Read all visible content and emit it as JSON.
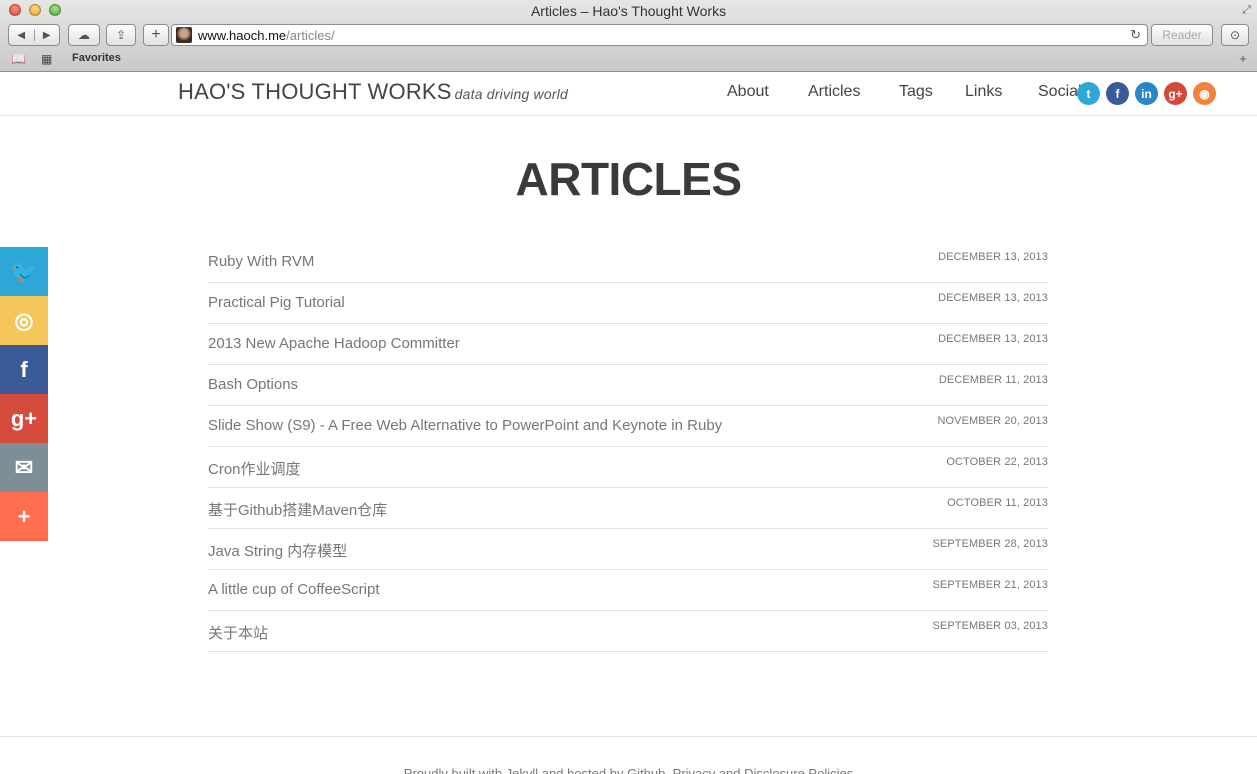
{
  "window": {
    "title": "Articles – Hao's Thought Works"
  },
  "toolbar": {
    "back_glyph": "◀",
    "forward_glyph": "▶",
    "cloud_glyph": "☁",
    "share_glyph": "⇪",
    "newtab_glyph": "+",
    "url_host": "www.haoch.me",
    "url_path": "/articles/",
    "reload_glyph": "↻",
    "reader_label": "Reader",
    "download_glyph": "⊙"
  },
  "bookmarks": {
    "book_glyph": "📖",
    "grid_glyph": "▦",
    "favorites_label": "Favorites",
    "add_glyph": "+"
  },
  "site": {
    "brand": "HAO'S THOUGHT WORKS",
    "tagline": "data driving world"
  },
  "nav": [
    "About",
    "Articles",
    "Tags",
    "Links",
    "Social"
  ],
  "social": [
    {
      "name": "twitter",
      "glyph": "t",
      "color": "#2fa6da"
    },
    {
      "name": "facebook",
      "glyph": "f",
      "color": "#3a5a98"
    },
    {
      "name": "linkedin",
      "glyph": "in",
      "color": "#2a86c4"
    },
    {
      "name": "googleplus",
      "glyph": "g+",
      "color": "#d34836"
    },
    {
      "name": "rss",
      "glyph": "◉",
      "color": "#f3813d"
    }
  ],
  "page": {
    "title": "ARTICLES"
  },
  "articles": [
    {
      "title": "Ruby With RVM",
      "date": "DECEMBER 13, 2013"
    },
    {
      "title": "Practical Pig Tutorial",
      "date": "DECEMBER 13, 2013"
    },
    {
      "title": "2013 New Apache Hadoop Committer",
      "date": "DECEMBER 13, 2013"
    },
    {
      "title": "Bash Options",
      "date": "DECEMBER 11, 2013"
    },
    {
      "title": "Slide Show (S9) - A Free Web Alternative to PowerPoint and Keynote in Ruby",
      "date": "NOVEMBER 20, 2013"
    },
    {
      "title": "Cron作业调度",
      "date": "OCTOBER 22, 2013"
    },
    {
      "title": "基于Github搭建Maven仓库",
      "date": "OCTOBER 11, 2013"
    },
    {
      "title": "Java String 内存模型",
      "date": "SEPTEMBER 28, 2013"
    },
    {
      "title": "A little cup of CoffeeScript",
      "date": "SEPTEMBER 21, 2013"
    },
    {
      "title": "关于本站",
      "date": "SEPTEMBER 03, 2013"
    }
  ],
  "share": [
    {
      "name": "twitter",
      "glyph": "🐦",
      "color": "#2ea6d8"
    },
    {
      "name": "weibo",
      "glyph": "◎",
      "color": "#f5c75a"
    },
    {
      "name": "facebook",
      "glyph": "f",
      "color": "#3b5a98"
    },
    {
      "name": "googleplus",
      "glyph": "g+",
      "color": "#d54b3c"
    },
    {
      "name": "email",
      "glyph": "✉",
      "color": "#7c8f96"
    },
    {
      "name": "more",
      "glyph": "+",
      "color": "#ff6f4f"
    }
  ],
  "footer": {
    "text": "Proudly built with Jekyll and hosted by Github. Privacy and Disclosure Policies"
  }
}
